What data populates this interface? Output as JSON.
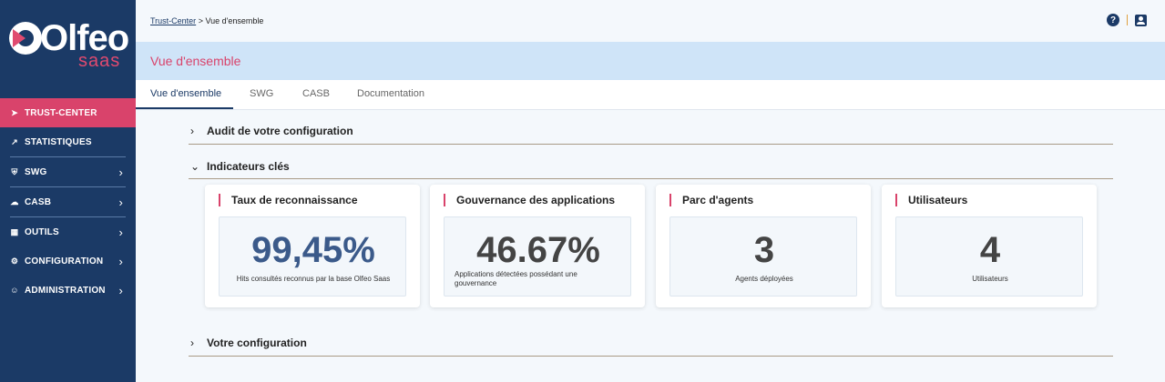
{
  "logo": {
    "text": "Olfeo",
    "sub": "saas"
  },
  "sidebar": {
    "items": [
      {
        "label": "TRUST-CENTER",
        "icon": "arrow-in-icon",
        "active": true,
        "chevron": false
      },
      {
        "label": "STATISTIQUES",
        "icon": "trend-icon",
        "active": false,
        "chevron": false
      },
      {
        "label": "SWG",
        "icon": "shield-icon",
        "active": false,
        "chevron": true
      },
      {
        "label": "CASB",
        "icon": "cloud-icon",
        "active": false,
        "chevron": true
      },
      {
        "label": "OUTILS",
        "icon": "tools-icon",
        "active": false,
        "chevron": true
      },
      {
        "label": "CONFIGURATION",
        "icon": "gear-icon",
        "active": false,
        "chevron": true
      },
      {
        "label": "ADMINISTRATION",
        "icon": "users-icon",
        "active": false,
        "chevron": true
      }
    ]
  },
  "breadcrumb": {
    "link": "Trust-Center",
    "separator": " > ",
    "current": "Vue d'ensemble"
  },
  "page_title": "Vue d'ensemble",
  "tabs": [
    "Vue d'ensemble",
    "SWG",
    "CASB",
    "Documentation"
  ],
  "sections": {
    "audit": "Audit de votre configuration",
    "indicators": "Indicateurs clés",
    "config": "Votre configuration"
  },
  "cards": [
    {
      "title": "Taux de reconnaissance",
      "value": "99,45%",
      "desc": "Hits consultés reconnus par la base Olfeo Saas",
      "value_color": "#3b5a8a"
    },
    {
      "title": "Gouvernance des applications",
      "value": "46.67%",
      "desc": "Applications détectées possédant une gouvernance",
      "value_color": "#444444"
    },
    {
      "title": "Parc d'agents",
      "value": "3",
      "desc": "Agents déployées",
      "value_color": "#444444"
    },
    {
      "title": "Utilisateurs",
      "value": "4",
      "desc": "Utilisateurs",
      "value_color": "#444444"
    }
  ],
  "colors": {
    "sidebar": "#1b3a66",
    "accent": "#d9436b",
    "band": "#cfe4f8"
  }
}
